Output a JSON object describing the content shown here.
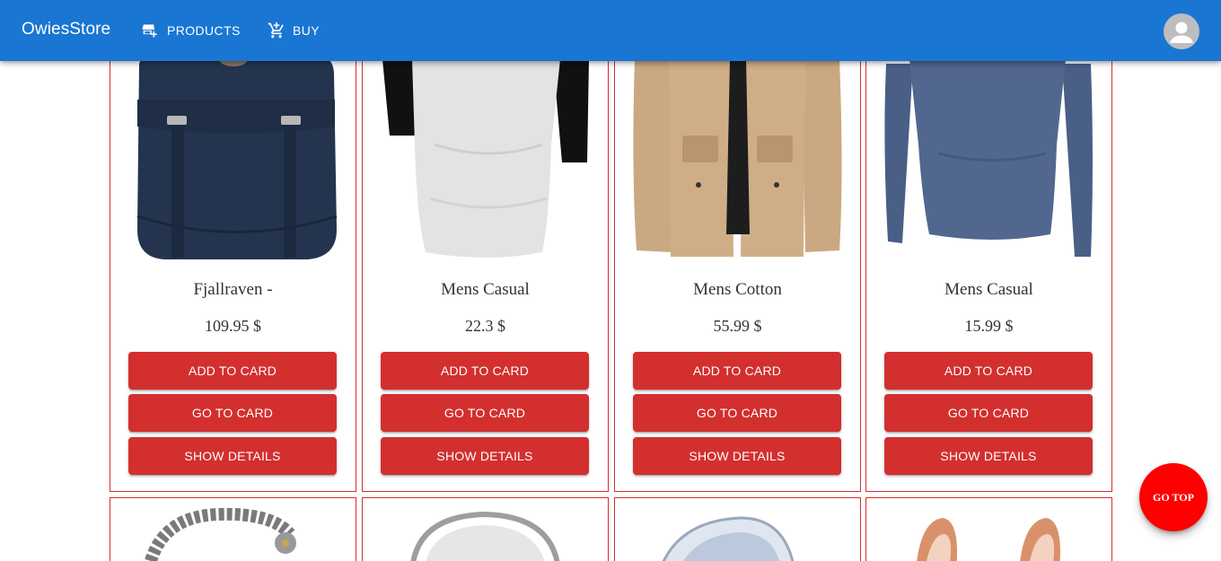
{
  "header": {
    "brand": "OwiesStore",
    "nav": [
      {
        "label": "PRODUCTS",
        "icon": "store-add-icon"
      },
      {
        "label": "BUY",
        "icon": "cart-add-icon"
      }
    ],
    "avatar_icon": "account-icon"
  },
  "products": [
    {
      "title": "Fjallraven -",
      "price": "109.95 $",
      "add_label": "ADD TO CARD",
      "go_label": "GO TO CARD",
      "details_label": "SHOW DETAILS"
    },
    {
      "title": "Mens Casual",
      "price": "22.3 $",
      "add_label": "ADD TO CARD",
      "go_label": "GO TO CARD",
      "details_label": "SHOW DETAILS"
    },
    {
      "title": "Mens Cotton",
      "price": "55.99 $",
      "add_label": "ADD TO CARD",
      "go_label": "GO TO CARD",
      "details_label": "SHOW DETAILS"
    },
    {
      "title": "Mens Casual",
      "price": "15.99 $",
      "add_label": "ADD TO CARD",
      "go_label": "GO TO CARD",
      "details_label": "SHOW DETAILS"
    }
  ],
  "go_top_label": "GO TOP",
  "colors": {
    "appbar": "#1976d2",
    "button": "#d32f2f",
    "card_border": "#d32f2f",
    "fab": "#ff0000"
  }
}
